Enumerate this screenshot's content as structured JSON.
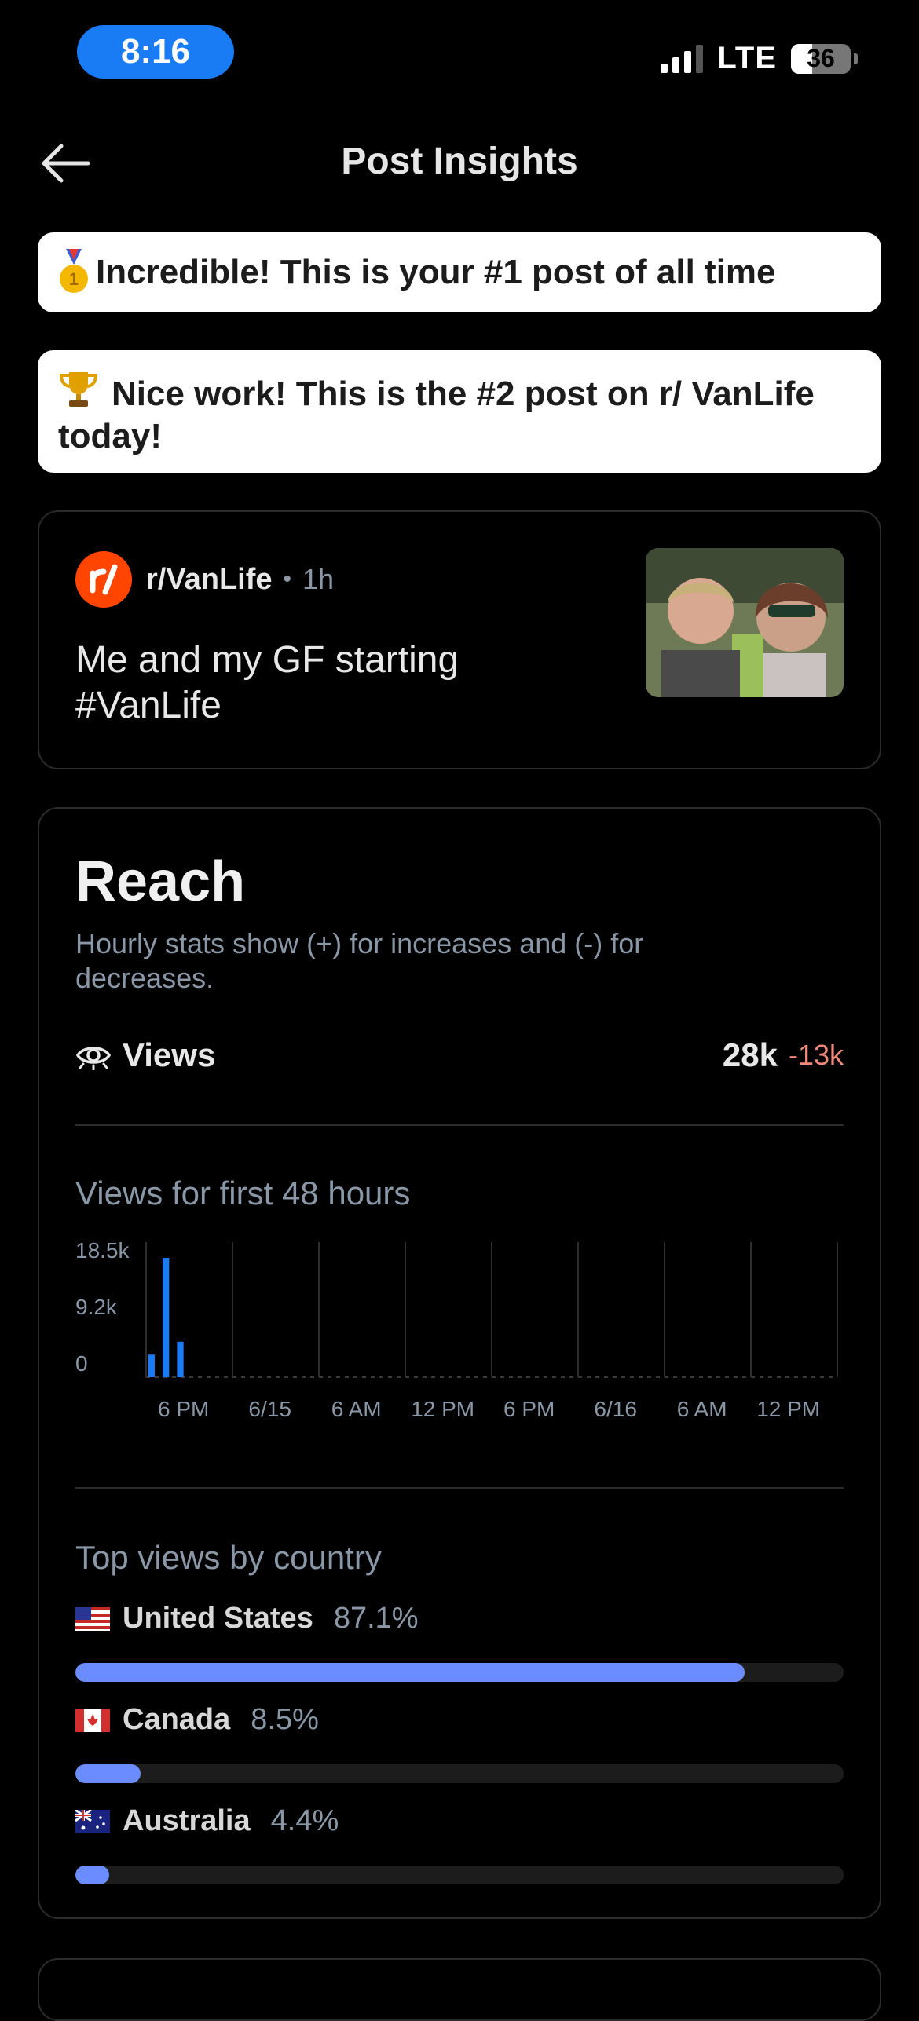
{
  "status_bar": {
    "time": "8:16",
    "network": "LTE",
    "battery": "36"
  },
  "header": {
    "title": "Post Insights"
  },
  "banners": [
    {
      "text": "Incredible! This is your #1 post of all time"
    },
    {
      "text": "Nice work! This is the #2 post on r/ VanLife today!"
    }
  ],
  "post": {
    "subreddit": "r/VanLife",
    "separator": "•",
    "age": "1h",
    "title": "Me and my GF starting #VanLife"
  },
  "reach": {
    "title": "Reach",
    "subtitle": "Hourly stats show (+) for increases and (-) for decreases.",
    "views_label": "Views",
    "views_value": "28k",
    "views_delta": "-13k",
    "chart_title": "Views for first 48 hours",
    "countries_title": "Top views by country",
    "countries": [
      {
        "name": "United States",
        "pct_label": "87.1%",
        "pct": 87.1,
        "flag": "us-flag"
      },
      {
        "name": "Canada",
        "pct_label": "8.5%",
        "pct": 8.5,
        "flag": "ca-flag"
      },
      {
        "name": "Australia",
        "pct_label": "4.4%",
        "pct": 4.4,
        "flag": "au-flag"
      }
    ]
  },
  "chart_data": {
    "type": "bar",
    "title": "Views for first 48 hours",
    "y_ticks": [
      "18.5k",
      "9.2k",
      "0"
    ],
    "x_ticks": [
      "6 PM",
      "6/15",
      "6 AM",
      "12 PM",
      "6 PM",
      "6/16",
      "6 AM",
      "12 PM"
    ],
    "ylim": [
      0,
      18500
    ],
    "bars": [
      {
        "hour": 0,
        "value": 3500
      },
      {
        "hour": 1,
        "value": 18500
      },
      {
        "hour": 2,
        "value": 5500
      }
    ],
    "hours": 48,
    "bar_color": "#1a7cf5"
  },
  "colors": {
    "accent": "#1a7cf5",
    "country_bar": "#6b8cff",
    "negative": "#f08a78",
    "subreddit": "#ff4500"
  }
}
